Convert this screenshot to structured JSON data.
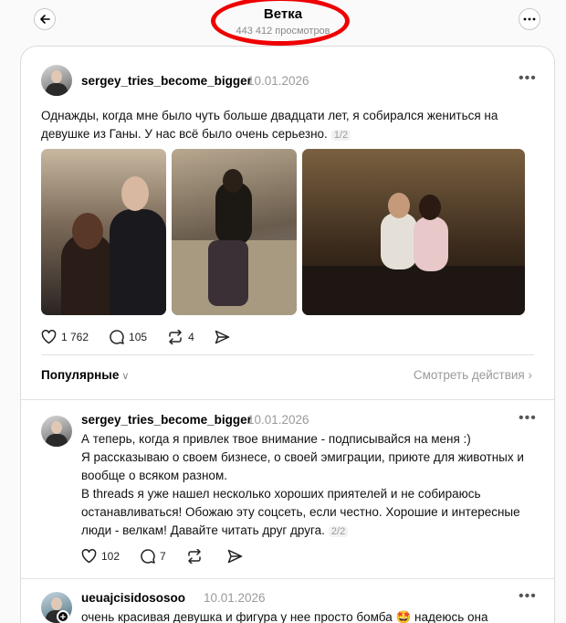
{
  "header": {
    "title": "Ветка",
    "views": "443 412 просмотров"
  },
  "post1": {
    "username": "sergey_tries_become_bigger",
    "date": "10.01.2026",
    "text_line1": "Однажды, когда мне было чуть больше двадцати лет, я собирался жениться на",
    "text_line2": "девушке из Ганы. У нас всё было очень серьезно.",
    "pagination": "1/2",
    "likes": "1 762",
    "comments": "105",
    "reposts": "4"
  },
  "sort": {
    "label": "Популярные",
    "view_activity": "Смотреть действия"
  },
  "post2": {
    "username": "sergey_tries_become_bigger",
    "date": "10.01.2026",
    "lines": [
      "А теперь, когда я привлек твое внимание - подписывайся на меня :)",
      "Я рассказываю о своем бизнесе, о своей эмиграции, приюте для животных и",
      "вообще о всяком разном.",
      "В threads я уже нашел несколько хороших приятелей и не собираюсь",
      "останавливаться! Обожаю эту соцсеть, если честно. Хорошие и интересные",
      "люди - велкам! Давайте читать друг друга."
    ],
    "pagination": "2/2",
    "likes": "102",
    "comments": "7"
  },
  "post3": {
    "username": "ueuajcisidososoo",
    "date": "10.01.2026",
    "text": "очень красивая девушка и фигура у нее просто бомба 🤩 надеюсь она"
  },
  "icons": {
    "back": "arrow-left-icon",
    "more": "more-icon",
    "like": "heart-icon",
    "comment": "comment-icon",
    "repost": "repost-icon",
    "share": "send-icon"
  }
}
